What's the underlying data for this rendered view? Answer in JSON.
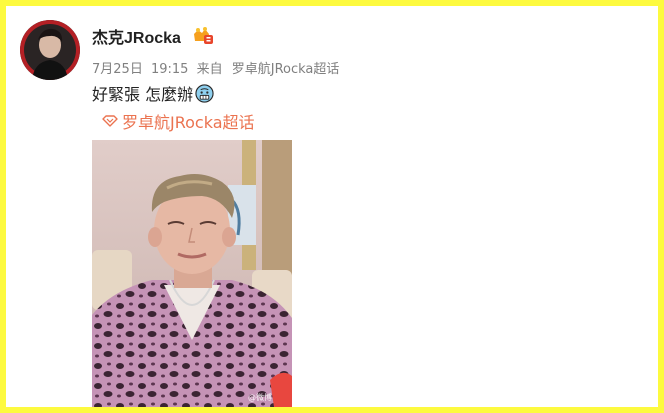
{
  "post": {
    "author": "杰克JRocka",
    "date": "7月25日",
    "time": "19:15",
    "source_label": "来自",
    "source": "罗卓航JRocka超话",
    "text": "好緊張 怎麼辦",
    "text_emoji": "cold-sweat-face-icon",
    "topic": "罗卓航JRocka超话",
    "watermark": "@微博"
  },
  "colors": {
    "frame": "#fdfa3f",
    "link": "#eb7350",
    "meta": "#808080",
    "text": "#222222"
  }
}
